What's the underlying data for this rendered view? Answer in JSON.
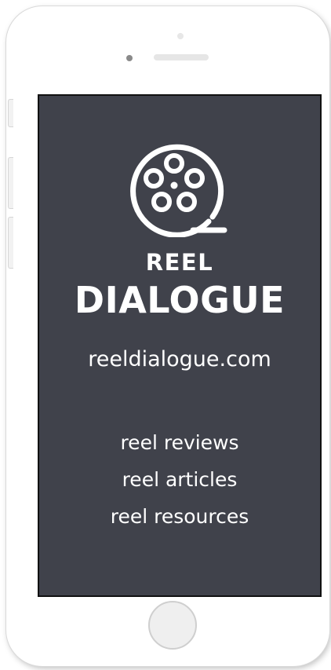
{
  "brand": {
    "line1": "REEL",
    "line2": "DIALOGUE",
    "logo_icon": "film-reel-icon"
  },
  "site_url": "reeldialogue.com",
  "nav": {
    "items": [
      {
        "label": "reel reviews"
      },
      {
        "label": "reel articles"
      },
      {
        "label": "reel resources"
      }
    ]
  },
  "colors": {
    "screen_bg": "#40424b",
    "text": "#ffffff",
    "device_body": "#ffffff"
  }
}
